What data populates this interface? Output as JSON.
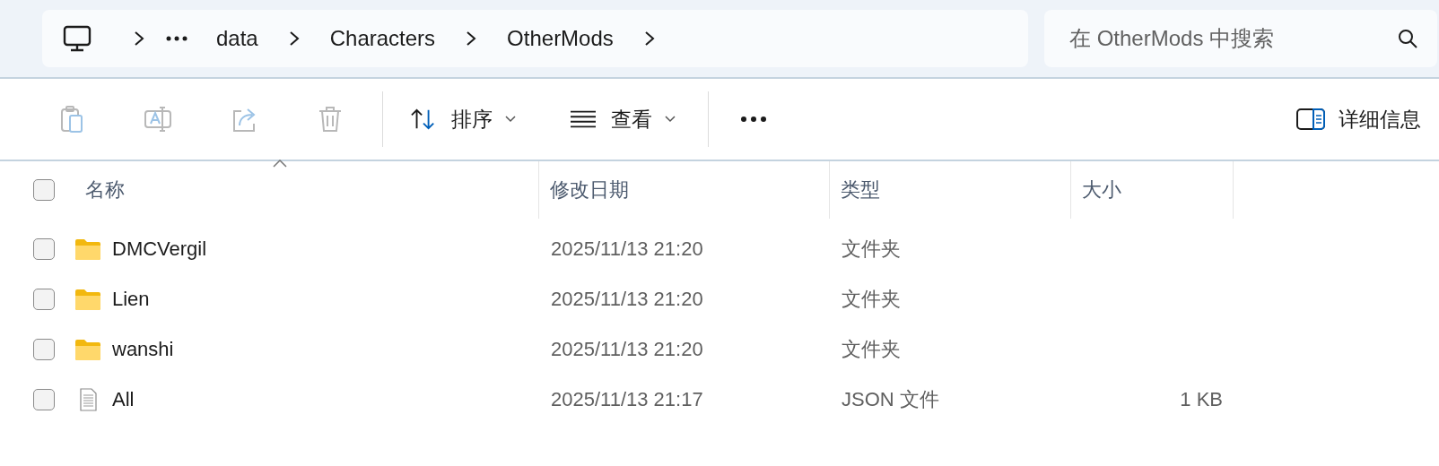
{
  "address_bar": {
    "segments": [
      "data",
      "Characters",
      "OtherMods"
    ]
  },
  "search": {
    "placeholder": "在 OtherMods 中搜索"
  },
  "toolbar": {
    "actions": [
      {
        "kind": "paste",
        "disabled": true
      },
      {
        "kind": "rename",
        "disabled": true
      },
      {
        "kind": "share",
        "disabled": true
      },
      {
        "kind": "delete",
        "disabled": true
      }
    ],
    "menus": [
      {
        "kind": "sort",
        "label": "排序"
      },
      {
        "kind": "view",
        "label": "查看"
      }
    ],
    "details": {
      "label": "详细信息"
    }
  },
  "table": {
    "select_all_checked": false,
    "columns": [
      {
        "label": "名称",
        "sorted": true
      },
      {
        "label": "修改日期",
        "sorted": false
      },
      {
        "label": "类型",
        "sorted": false
      },
      {
        "label": "大小",
        "sorted": false
      }
    ],
    "rows": [
      {
        "kind": "folder",
        "name": "DMCVergil",
        "modified": "2025/11/13 21:20",
        "type": "文件夹",
        "checked": false
      },
      {
        "kind": "folder",
        "name": "Lien",
        "modified": "2025/11/13 21:20",
        "type": "文件夹",
        "checked": false
      },
      {
        "kind": "folder",
        "name": "wanshi",
        "modified": "2025/11/13 21:20",
        "type": "文件夹",
        "checked": false
      },
      {
        "kind": "file",
        "name": "All",
        "modified": "2025/11/13 21:17",
        "type": "JSON 文件",
        "size": "1 KB",
        "checked": false
      }
    ]
  }
}
